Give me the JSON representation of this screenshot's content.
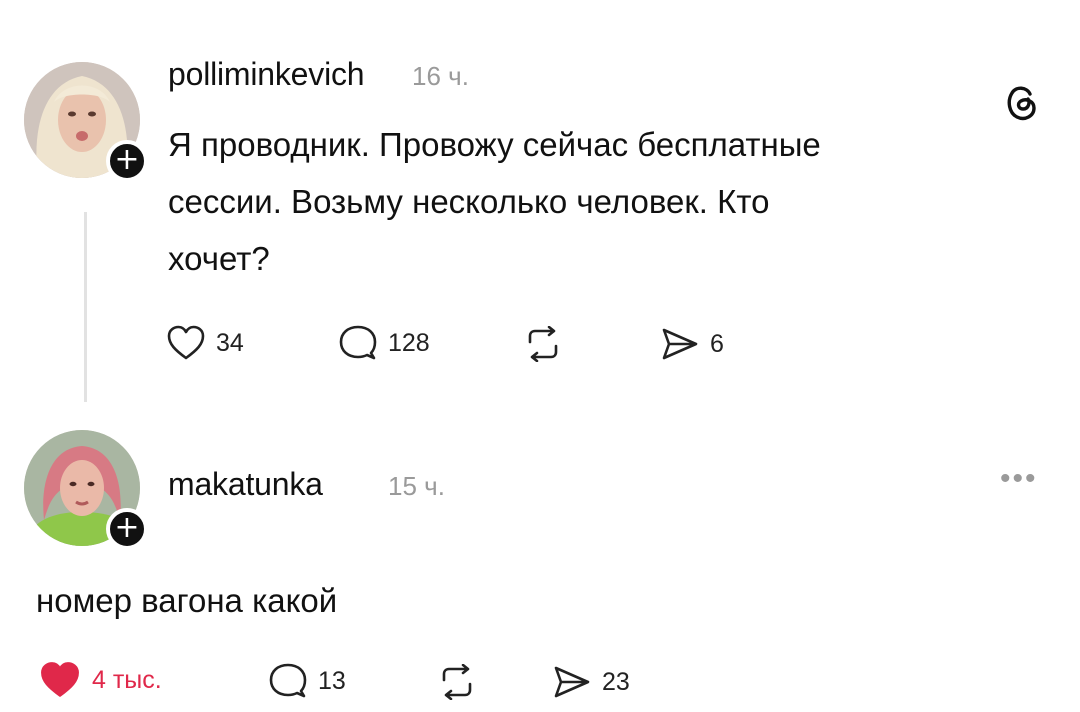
{
  "posts": [
    {
      "username": "polliminkevich",
      "time": "16 ч.",
      "lines": [
        "Я проводник. Провожу сейчас бесплатные",
        "сессии. Возьму несколько человек. Кто",
        "хочет?"
      ],
      "likes": "34",
      "comments": "128",
      "shares": "6",
      "liked": false
    },
    {
      "username": "makatunka",
      "time": "15 ч.",
      "text": "номер вагона какой",
      "likes": "4 тыс.",
      "comments": "13",
      "shares": "23",
      "liked": true
    }
  ],
  "colors": {
    "like_active": "#e0284a",
    "muted": "#9a9a9a",
    "text": "#111111"
  },
  "icons": {
    "header": "threads-logo-icon",
    "more": "more-dots-icon",
    "actions": [
      "heart-icon",
      "comment-bubble-icon",
      "repost-icon",
      "share-send-icon"
    ]
  }
}
